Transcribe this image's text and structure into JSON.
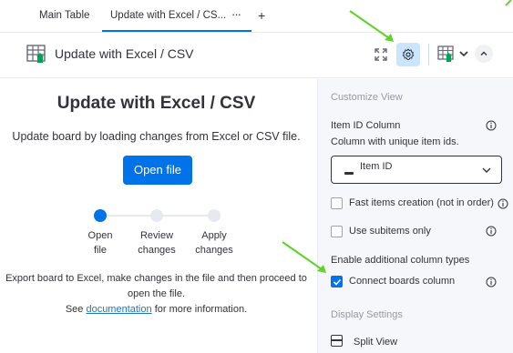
{
  "tabs": {
    "items": [
      {
        "label": "Main Table"
      },
      {
        "label": "Update with Excel / CS..."
      }
    ],
    "more_label": "···",
    "add_label": "+"
  },
  "header": {
    "title": "Update with Excel / CSV"
  },
  "main": {
    "title": "Update with Excel / CSV",
    "subtitle": "Update board by loading changes from Excel or CSV file.",
    "open_button": "Open file",
    "steps": [
      {
        "label_line1": "Open",
        "label_line2": "file",
        "active": true
      },
      {
        "label_line1": "Review",
        "label_line2": "changes",
        "active": false
      },
      {
        "label_line1": "Apply",
        "label_line2": "changes",
        "active": false
      }
    ],
    "note_line1": "Export board to Excel, make changes in the file and then proceed to",
    "note_line2": "open the file.",
    "note_see": "See",
    "note_link": "documentation",
    "note_after": "for more information."
  },
  "settings": {
    "section_customize": "Customize View",
    "item_id_label": "Item ID Column",
    "item_id_desc": "Column with unique item ids.",
    "item_id_value": "Item ID",
    "fast_creation_label": "Fast items creation (not in order)",
    "fast_creation_checked": false,
    "subitems_label": "Use subitems only",
    "subitems_checked": false,
    "additional_types_label": "Enable additional column types",
    "connect_boards_label": "Connect boards column",
    "connect_boards_checked": true,
    "section_display": "Display Settings",
    "split_view_label": "Split View"
  },
  "colors": {
    "accent": "#0073ea",
    "gear_bg": "#cce5ff",
    "panel_bg": "#f6f7fb",
    "annotation_arrow": "#5fd42a",
    "sheet_green": "#00a34f"
  }
}
